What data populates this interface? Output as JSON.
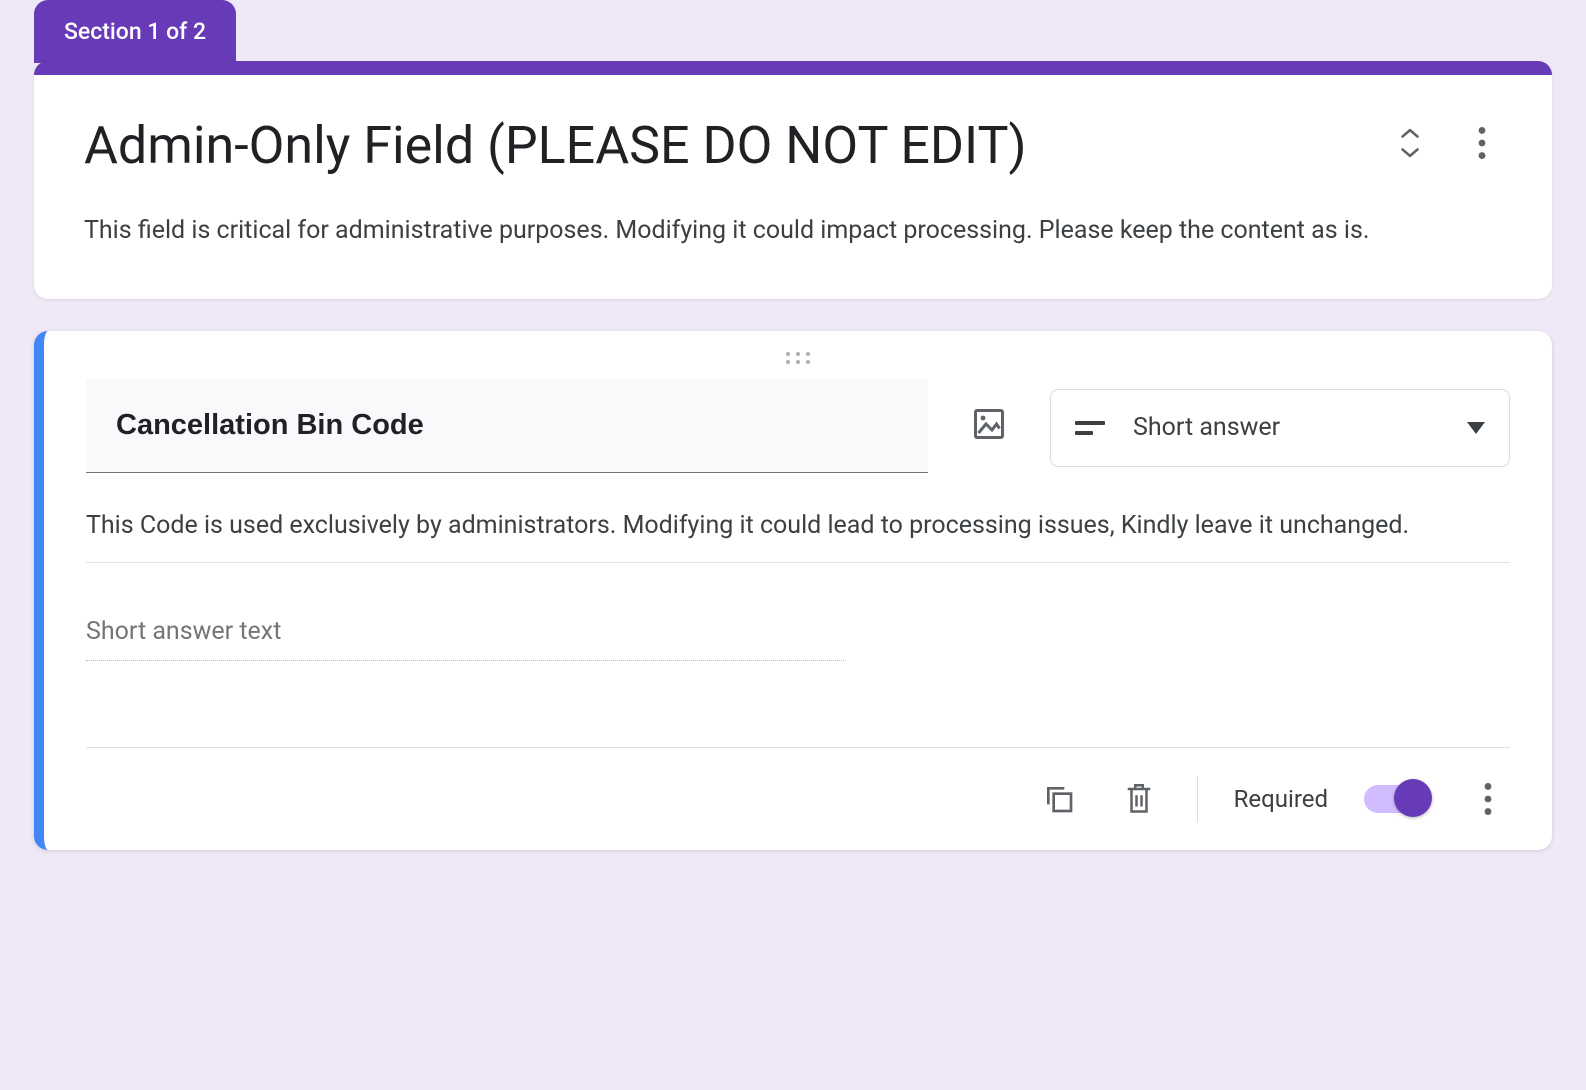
{
  "section_tab": "Section 1 of 2",
  "header": {
    "title": "Admin-Only Field (PLEASE DO NOT EDIT)",
    "description": "This field is critical for administrative purposes. Modifying it could impact processing. Please keep the content as is."
  },
  "question": {
    "title": "Cancellation Bin Code",
    "description": "This Code is used exclusively by administrators. Modifying it could lead to processing issues, Kindly leave it unchanged.",
    "answer_placeholder": "Short answer text",
    "type_label": "Short answer",
    "required_label": "Required",
    "required_on": true
  },
  "colors": {
    "accent": "#673ab7",
    "selection": "#4285f4"
  }
}
